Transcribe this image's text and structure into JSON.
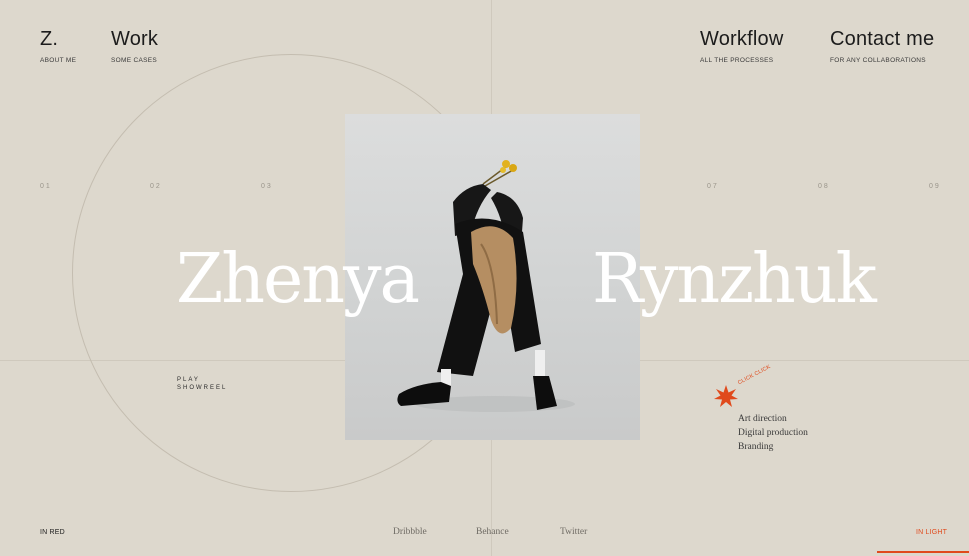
{
  "nav": {
    "brand": {
      "title": "Z.",
      "sub": "ABOUT ME"
    },
    "work": {
      "title": "Work",
      "sub": "SOME CASES"
    },
    "workflow": {
      "title": "Workflow",
      "sub": "ALL THE PROCESSES"
    },
    "contact": {
      "title": "Contact me",
      "sub": "FOR ANY COLLABORATIONS"
    }
  },
  "section_numbers": [
    "01",
    "02",
    "03",
    "07",
    "08",
    "09"
  ],
  "hero": {
    "first_name": "Zhenya",
    "last_name": "Rynzhuk"
  },
  "showreel": {
    "line1": "PLAY",
    "line2": "SHOWREEL"
  },
  "badge": {
    "label": "CLICK CLICK",
    "icon": "starburst-icon"
  },
  "services": [
    "Art direction",
    "Digital production",
    "Branding"
  ],
  "footer": {
    "left": "IN RED",
    "right": "IN LIGHT",
    "social": [
      "Dribbble",
      "Behance",
      "Twitter"
    ]
  },
  "colors": {
    "background": "#ddd8cd",
    "accent": "#e04a1c",
    "hero_text": "#ffffff"
  }
}
